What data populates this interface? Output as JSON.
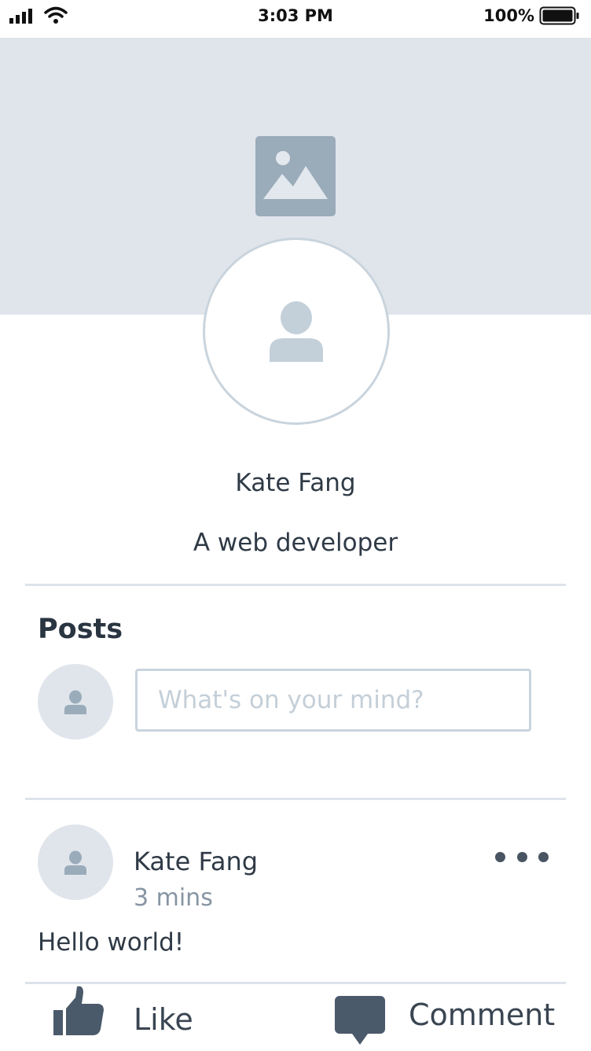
{
  "status_bar": {
    "time": "3:03 PM",
    "battery_percent": "100%",
    "icons": [
      "signal-icon",
      "wifi-icon",
      "battery-icon"
    ]
  },
  "cover": {
    "icon": "image-placeholder-icon"
  },
  "profile": {
    "name": "Kate Fang",
    "bio": "A web developer",
    "avatar_icon": "user-icon"
  },
  "posts": {
    "heading": "Posts",
    "compose": {
      "placeholder": "What's on your mind?"
    },
    "items": [
      {
        "author": "Kate Fang",
        "time": "3 mins",
        "body": "Hello world!",
        "actions": [
          {
            "label": "Like",
            "icon": "thumbs-up-icon"
          },
          {
            "label": "Comment",
            "icon": "comment-icon"
          }
        ]
      }
    ]
  },
  "colors": {
    "cover_bg": "#e0e5ec",
    "icon_gray": "#9aabb9",
    "avatar_border": "#c9d4dd",
    "text_dark": "#2f3a46",
    "text_muted": "#8795a3",
    "action_icon": "#4a5a6a"
  }
}
